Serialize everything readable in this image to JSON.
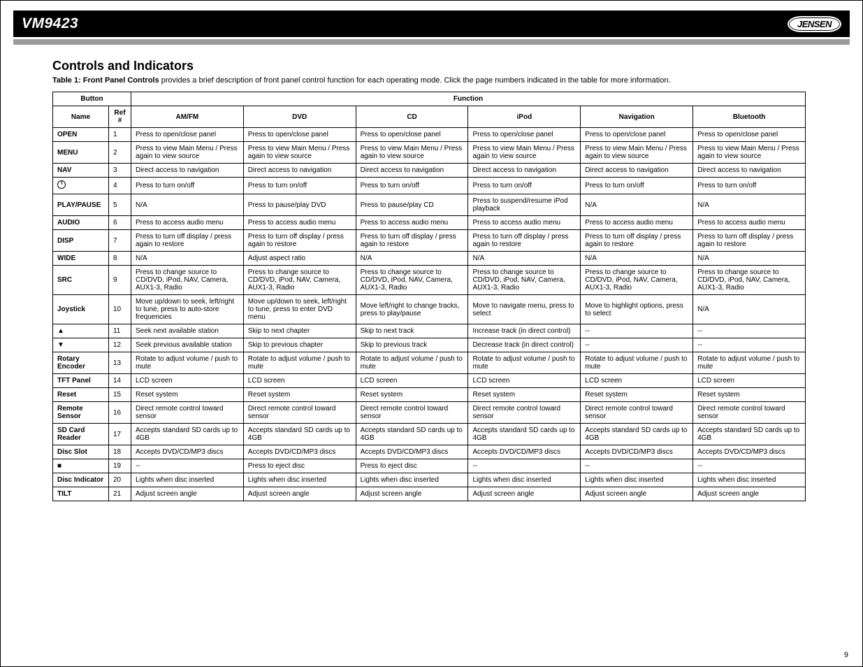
{
  "header": {
    "title": "VM9423",
    "brand": "JENSEN"
  },
  "section": {
    "heading": "Controls and Indicators",
    "subtitle_bold": "Table 1: Front Panel Controls ",
    "subtitle_plain": "provides a brief description of front panel control function for each operating mode. Click the page numbers indicated in the table for more information."
  },
  "table": {
    "head_button": "Button",
    "head_function": "Function",
    "sub_name": "Name",
    "sub_ref": "Ref #",
    "sub_modes": [
      "AM/FM",
      "DVD",
      "CD",
      "iPod",
      "Navigation",
      "Bluetooth"
    ],
    "rows": [
      {
        "name": "OPEN",
        "ref": "1",
        "cells": [
          "Press to open/close panel",
          "Press to open/close panel",
          "Press to open/close panel",
          "Press to open/close panel",
          "Press to open/close panel",
          "Press to open/close panel"
        ]
      },
      {
        "name": "MENU",
        "ref": "2",
        "cells": [
          "Press to view Main Menu / Press again to view source",
          "Press to view Main Menu / Press again to view source",
          "Press to view Main Menu / Press again to view source",
          "Press to view Main Menu / Press again to view source",
          "Press to view Main Menu / Press again to view source",
          "Press to view Main Menu / Press again to view source"
        ]
      },
      {
        "name": "NAV",
        "ref": "3",
        "cells": [
          "Direct access to navigation",
          "Direct access to navigation",
          "Direct access to navigation",
          "Direct access to navigation",
          "Direct access to navigation",
          "Direct access to navigation"
        ]
      },
      {
        "name": "POWER",
        "icon": "power",
        "ref": "4",
        "cells": [
          "Press to turn on/off",
          "Press to turn on/off",
          "Press to turn on/off",
          "Press to turn on/off",
          "Press to turn on/off",
          "Press to turn on/off"
        ]
      },
      {
        "name": "PLAY/PAUSE",
        "ref": "5",
        "cells": [
          "N/A",
          "Press to pause/play DVD",
          "Press to pause/play CD",
          "Press to suspend/resume iPod playback",
          "N/A",
          "N/A"
        ]
      },
      {
        "name": "AUDIO",
        "ref": "6",
        "cells": [
          "Press to access audio menu",
          "Press to access audio menu",
          "Press to access audio menu",
          "Press to access audio menu",
          "Press to access audio menu",
          "Press to access audio menu"
        ]
      },
      {
        "name": "DISP",
        "ref": "7",
        "cells": [
          "Press to turn off display / press again to restore",
          "Press to turn off display / press again to restore",
          "Press to turn off display / press again to restore",
          "Press to turn off display / press again to restore",
          "Press to turn off display / press again to restore",
          "Press to turn off display / press again to restore"
        ]
      },
      {
        "name": "WIDE",
        "ref": "8",
        "cells": [
          "N/A",
          "Adjust aspect ratio",
          "N/A",
          "N/A",
          "N/A",
          "N/A"
        ]
      },
      {
        "name": "SRC",
        "ref": "9",
        "cells": [
          "Press to change source to CD/DVD, iPod, NAV, Camera, AUX1-3, Radio",
          "Press to change source to CD/DVD, iPod, NAV, Camera, AUX1-3, Radio",
          "Press to change source to CD/DVD, iPod, NAV, Camera, AUX1-3, Radio",
          "Press to change source to CD/DVD, iPod, NAV, Camera, AUX1-3, Radio",
          "Press to change source to CD/DVD, iPod, NAV, Camera, AUX1-3, Radio",
          "Press to change source to CD/DVD, iPod, NAV, Camera, AUX1-3, Radio"
        ]
      },
      {
        "name": "Joystick",
        "ref": "10",
        "cells": [
          "Move up/down to seek, left/right to tune, press to auto-store frequencies",
          "Move up/down to seek, left/right to tune, press to enter DVD menu",
          "Move left/right to change tracks, press to play/pause",
          "Move to navigate menu, press to select",
          "Move to highlight options, press to select",
          "N/A"
        ]
      },
      {
        "name": "UP",
        "icon": "up",
        "ref": "11",
        "cells": [
          "Seek next available station",
          "Skip to next chapter",
          "Skip to next track",
          "Increase track (in direct control)",
          "--",
          "--"
        ]
      },
      {
        "name": "DOWN",
        "icon": "down",
        "ref": "12",
        "cells": [
          "Seek previous available station",
          "Skip to previous chapter",
          "Skip to previous track",
          "Decrease track (in direct control)",
          "--",
          "--"
        ]
      },
      {
        "name": "Rotary Encoder",
        "ref": "13",
        "cells": [
          "Rotate to adjust volume / push to mute",
          "Rotate to adjust volume / push to mute",
          "Rotate to adjust volume / push to mute",
          "Rotate to adjust volume / push to mute",
          "Rotate to adjust volume / push to mute",
          "Rotate to adjust volume / push to mute"
        ]
      },
      {
        "name": "TFT Panel",
        "ref": "14",
        "cells": [
          "LCD screen",
          "LCD screen",
          "LCD screen",
          "LCD screen",
          "LCD screen",
          "LCD screen"
        ]
      },
      {
        "name": "Reset",
        "ref": "15",
        "cells": [
          "Reset system",
          "Reset system",
          "Reset system",
          "Reset system",
          "Reset system",
          "Reset system"
        ]
      },
      {
        "name": "Remote Sensor",
        "ref": "16",
        "cells": [
          "Direct remote control toward sensor",
          "Direct remote control toward sensor",
          "Direct remote control toward sensor",
          "Direct remote control toward sensor",
          "Direct remote control toward sensor",
          "Direct remote control toward sensor"
        ]
      },
      {
        "name": "SD Card Reader",
        "ref": "17",
        "cells": [
          "Accepts standard SD cards up to 4GB",
          "Accepts standard SD cards up to 4GB",
          "Accepts standard SD cards up to 4GB",
          "Accepts standard SD cards up to 4GB",
          "Accepts standard SD cards up to 4GB",
          "Accepts standard SD cards up to 4GB"
        ]
      },
      {
        "name": "Disc Slot",
        "ref": "18",
        "cells": [
          "Accepts DVD/CD/MP3 discs",
          "Accepts DVD/CD/MP3 discs",
          "Accepts DVD/CD/MP3 discs",
          "Accepts DVD/CD/MP3 discs",
          "Accepts DVD/CD/MP3 discs",
          "Accepts DVD/CD/MP3 discs"
        ]
      },
      {
        "name": "EJECT",
        "icon": "stop",
        "ref": "19",
        "cells": [
          "--",
          "Press to eject disc",
          "Press to eject disc",
          "--",
          "--",
          "--"
        ]
      },
      {
        "name": "Disc Indicator",
        "ref": "20",
        "cells": [
          "Lights when disc inserted",
          "Lights when disc inserted",
          "Lights when disc inserted",
          "Lights when disc inserted",
          "Lights when disc inserted",
          "Lights when disc inserted"
        ]
      },
      {
        "name": "TILT",
        "ref": "21",
        "cells": [
          "Adjust screen angle",
          "Adjust screen angle",
          "Adjust screen angle",
          "Adjust screen angle",
          "Adjust screen angle",
          "Adjust screen angle"
        ]
      }
    ]
  },
  "page_number": "9"
}
